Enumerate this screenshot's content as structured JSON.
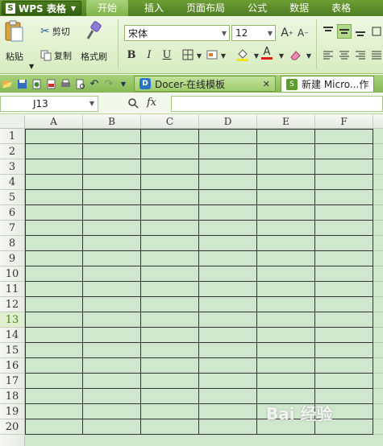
{
  "app": {
    "name": "WPS 表格",
    "logo": "S"
  },
  "menu": {
    "tabs": [
      "开始",
      "插入",
      "页面布局",
      "公式",
      "数据",
      "表格"
    ],
    "active": "开始"
  },
  "ribbon": {
    "paste": "粘贴",
    "cut": "剪切",
    "copy": "复制",
    "format_painter": "格式刷",
    "font_name": "宋体",
    "font_size": "12",
    "bold": "B",
    "italic": "I",
    "underline": "U",
    "font_color_letter": "A",
    "grow_font": "A",
    "shrink_font": "A"
  },
  "doc_tabs": [
    {
      "label": "Docer-在线模板",
      "icon": "docer-icon"
    },
    {
      "label": "新建 Micro...作",
      "icon": "sheet-icon"
    }
  ],
  "formula_bar": {
    "cell_ref": "J13",
    "fx": "fx",
    "value": ""
  },
  "grid": {
    "columns": [
      "A",
      "B",
      "C",
      "D",
      "E",
      "F"
    ],
    "rows": [
      "1",
      "2",
      "3",
      "4",
      "5",
      "6",
      "7",
      "8",
      "9",
      "10",
      "11",
      "12",
      "13",
      "14",
      "15",
      "16",
      "17",
      "18",
      "19",
      "20"
    ],
    "active_row": "13",
    "cell_fill": "#cfe8cd"
  },
  "watermark": "Bai 经验",
  "colors": {
    "accent": "#5e8f2a",
    "ribbon": "#e3f1d2"
  }
}
